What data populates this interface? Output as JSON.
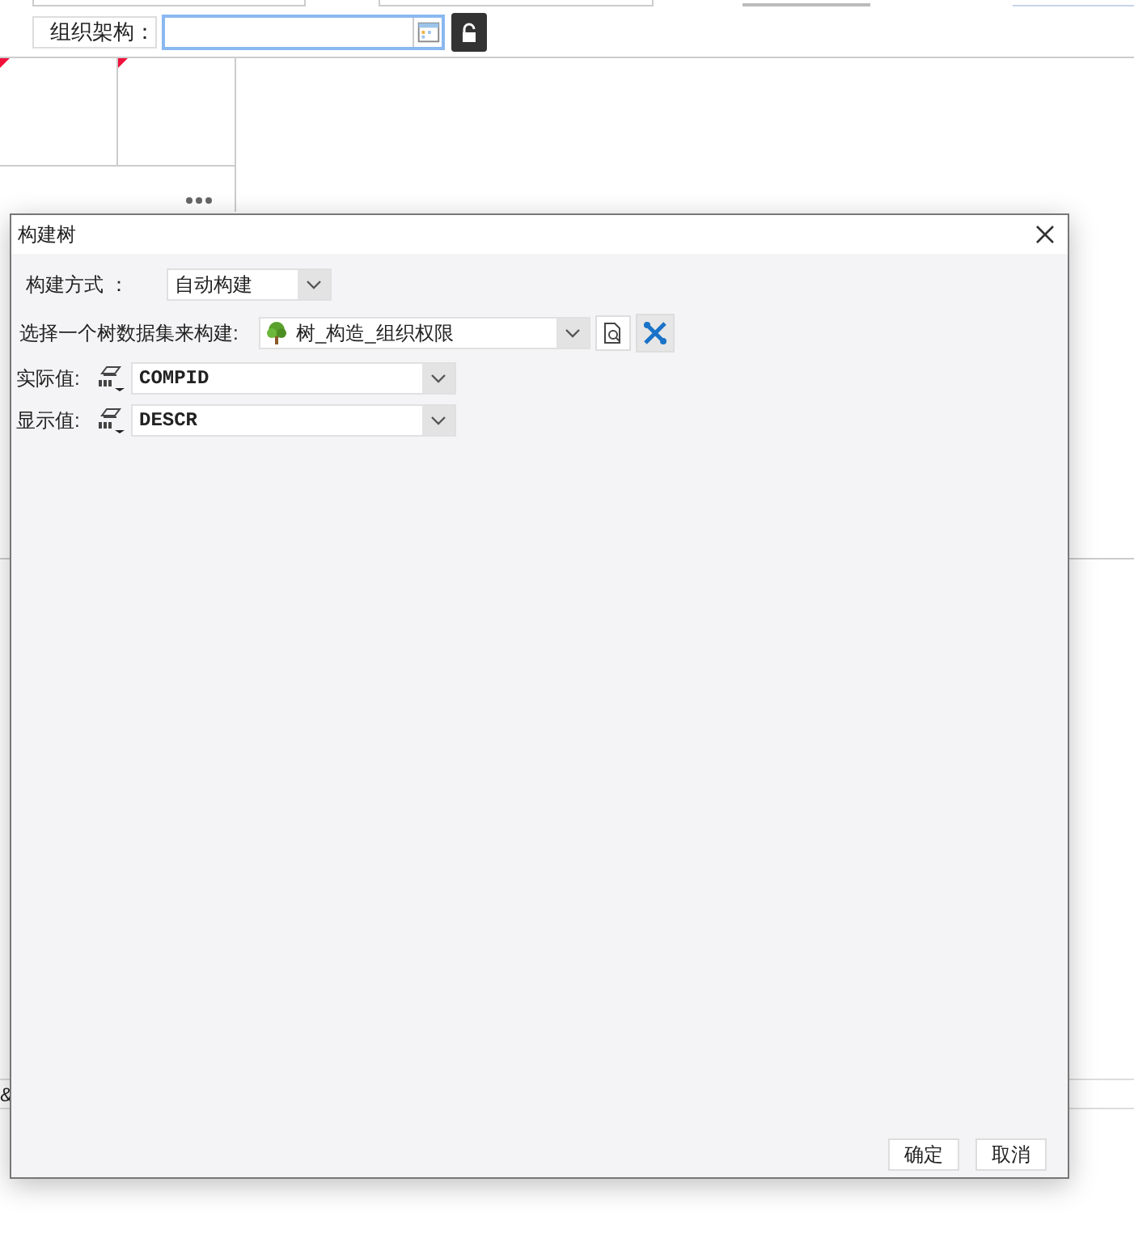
{
  "designer": {
    "field_label": "组织架构：",
    "locked": false,
    "edge_text": "&"
  },
  "dialog": {
    "title": "构建树",
    "build_mode": {
      "label": "构建方式 ：",
      "value": "自动构建"
    },
    "dataset": {
      "label": "选择一个树数据集来构建:",
      "value": "树_构造_组织权限"
    },
    "fields": [
      {
        "label": "实际值:",
        "value": "COMPID"
      },
      {
        "label": "显示值:",
        "value": "DESCR"
      }
    ],
    "buttons": [
      "确定",
      "取消"
    ]
  }
}
